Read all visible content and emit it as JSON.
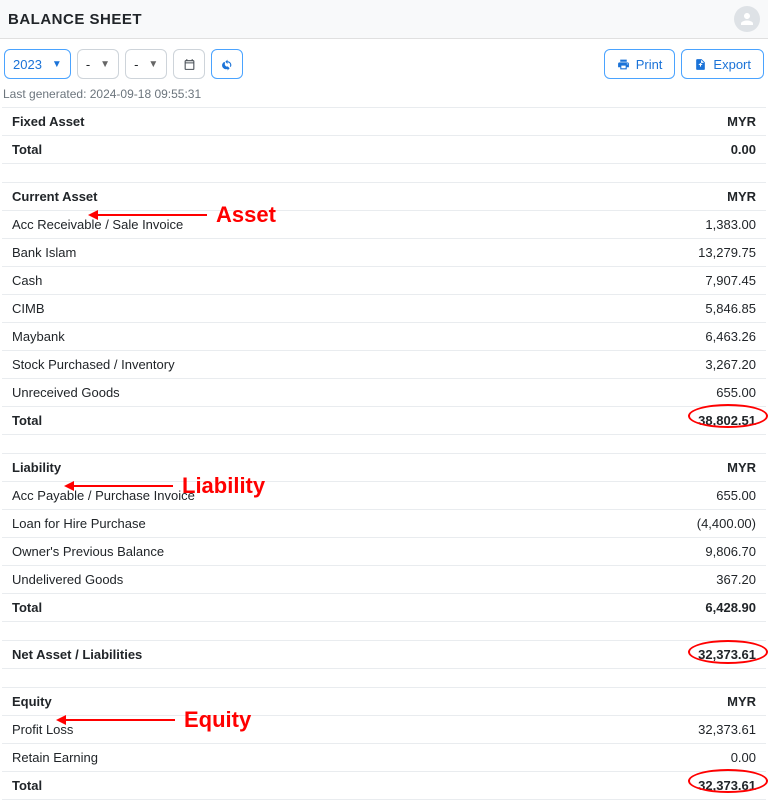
{
  "header": {
    "title": "BALANCE SHEET"
  },
  "toolbar": {
    "year": "2023",
    "dash1": "-",
    "dash2": "-",
    "print_label": "Print",
    "export_label": "Export"
  },
  "meta": {
    "last_generated": "Last generated: 2024-09-18 09:55:31"
  },
  "sections": {
    "fixed_asset": {
      "header_label": "Fixed Asset",
      "currency": "MYR",
      "total_label": "Total",
      "total_value": "0.00"
    },
    "current_asset": {
      "header_label": "Current Asset",
      "currency": "MYR",
      "rows": [
        {
          "label": "Acc Receivable / Sale Invoice",
          "value": "1,383.00"
        },
        {
          "label": "Bank Islam",
          "value": "13,279.75"
        },
        {
          "label": "Cash",
          "value": "7,907.45"
        },
        {
          "label": "CIMB",
          "value": "5,846.85"
        },
        {
          "label": "Maybank",
          "value": "6,463.26"
        },
        {
          "label": "Stock Purchased / Inventory",
          "value": "3,267.20"
        },
        {
          "label": "Unreceived Goods",
          "value": "655.00"
        }
      ],
      "total_label": "Total",
      "total_value": "38,802.51"
    },
    "liability": {
      "header_label": "Liability",
      "currency": "MYR",
      "rows": [
        {
          "label": "Acc Payable / Purchase Invoice",
          "value": "655.00"
        },
        {
          "label": "Loan for Hire Purchase",
          "value": "(4,400.00)"
        },
        {
          "label": "Owner's Previous Balance",
          "value": "9,806.70"
        },
        {
          "label": "Undelivered Goods",
          "value": "367.20"
        }
      ],
      "total_label": "Total",
      "total_value": "6,428.90"
    },
    "net": {
      "label": "Net Asset / Liabilities",
      "value": "32,373.61"
    },
    "equity": {
      "header_label": "Equity",
      "currency": "MYR",
      "rows": [
        {
          "label": "Profit Loss",
          "value": "32,373.61"
        },
        {
          "label": "Retain Earning",
          "value": "0.00"
        }
      ],
      "total_label": "Total",
      "total_value": "32,373.61"
    }
  },
  "annotations": {
    "asset": "Asset",
    "liability": "Liability",
    "equity": "Equity"
  }
}
